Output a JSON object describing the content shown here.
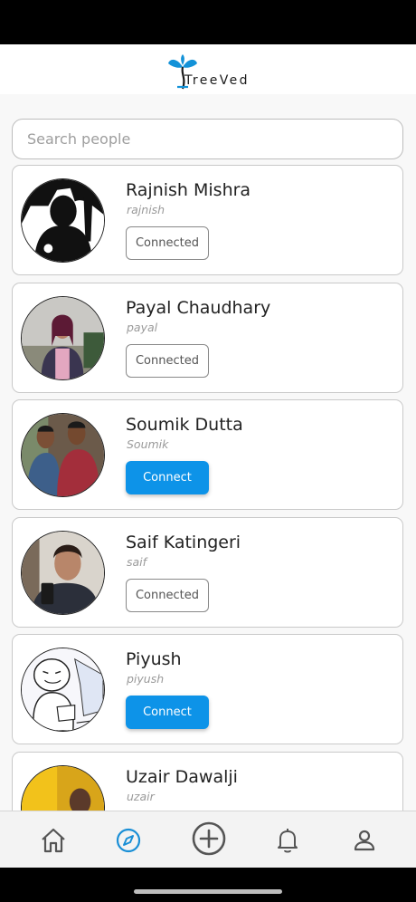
{
  "app": {
    "brand_name": "TreeVed",
    "brand_color": "#1392d8"
  },
  "search": {
    "placeholder": "Search people",
    "value": ""
  },
  "people": [
    {
      "name": "Rajnish Mishra",
      "handle": "rajnish",
      "button_label": "Connected",
      "status": "connected"
    },
    {
      "name": "Payal Chaudhary",
      "handle": "payal",
      "button_label": "Connected",
      "status": "connected"
    },
    {
      "name": "Soumik Dutta",
      "handle": "Soumik",
      "button_label": "Connect",
      "status": "not_connected"
    },
    {
      "name": "Saif Katingeri",
      "handle": "saif",
      "button_label": "Connected",
      "status": "connected"
    },
    {
      "name": "Piyush",
      "handle": "piyush",
      "button_label": "Connect",
      "status": "not_connected"
    },
    {
      "name": "Uzair Dawalji",
      "handle": "uzair",
      "button_label": "",
      "status": "unknown"
    }
  ],
  "bottom_nav": {
    "active_item": "explore",
    "items": [
      {
        "id": "home",
        "icon": "home-icon"
      },
      {
        "id": "explore",
        "icon": "compass-icon"
      },
      {
        "id": "create",
        "icon": "plus-circle-icon"
      },
      {
        "id": "notifications",
        "icon": "bell-icon"
      },
      {
        "id": "profile",
        "icon": "person-icon"
      }
    ]
  },
  "colors": {
    "accent": "#0d93e8",
    "active_nav": "#1a8fd6",
    "inactive_nav": "#555555"
  }
}
